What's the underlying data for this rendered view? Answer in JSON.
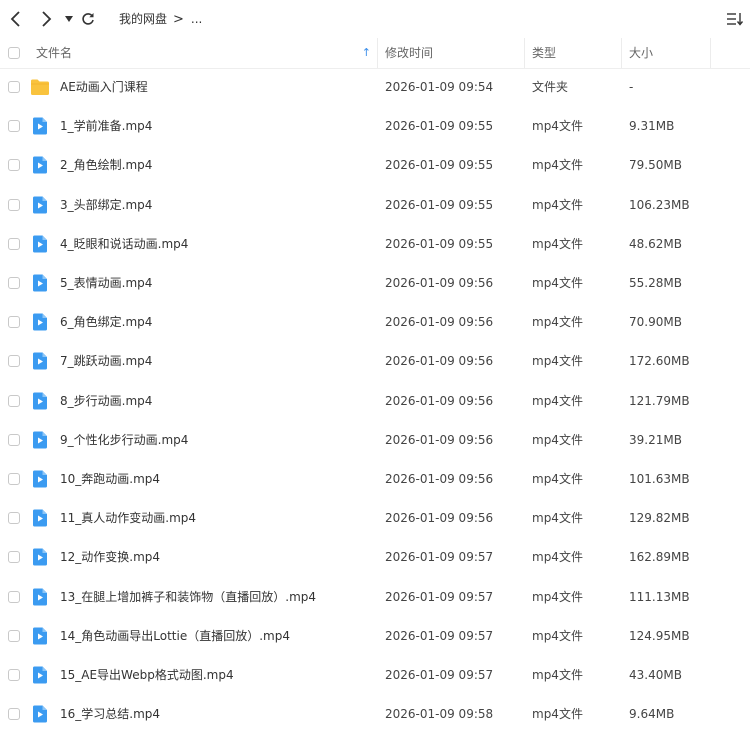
{
  "toolbar": {
    "breadcrumb_root": "我的网盘",
    "breadcrumb_sep": ">",
    "breadcrumb_more": "...",
    "icons": {
      "back": "chevron-left-icon",
      "forward": "chevron-right-icon",
      "history": "dropdown-triangle-icon",
      "refresh": "refresh-icon",
      "sort": "sort-list-icon"
    }
  },
  "columns": {
    "name": "文件名",
    "modified": "修改时间",
    "type": "类型",
    "size": "大小",
    "sort_indicator": "↑"
  },
  "colors": {
    "folder": "#F9C33E",
    "video": "#3B9BF1",
    "sort_arrow": "#3B8EEA"
  },
  "files": [
    {
      "name": "AE动画入门课程",
      "modified": "2026-01-09 09:54",
      "type": "文件夹",
      "size": "-",
      "kind": "folder"
    },
    {
      "name": "1_学前准备.mp4",
      "modified": "2026-01-09 09:55",
      "type": "mp4文件",
      "size": "9.31MB",
      "kind": "video"
    },
    {
      "name": "2_角色绘制.mp4",
      "modified": "2026-01-09 09:55",
      "type": "mp4文件",
      "size": "79.50MB",
      "kind": "video"
    },
    {
      "name": "3_头部绑定.mp4",
      "modified": "2026-01-09 09:55",
      "type": "mp4文件",
      "size": "106.23MB",
      "kind": "video"
    },
    {
      "name": "4_眨眼和说话动画.mp4",
      "modified": "2026-01-09 09:55",
      "type": "mp4文件",
      "size": "48.62MB",
      "kind": "video"
    },
    {
      "name": "5_表情动画.mp4",
      "modified": "2026-01-09 09:56",
      "type": "mp4文件",
      "size": "55.28MB",
      "kind": "video"
    },
    {
      "name": "6_角色绑定.mp4",
      "modified": "2026-01-09 09:56",
      "type": "mp4文件",
      "size": "70.90MB",
      "kind": "video"
    },
    {
      "name": "7_跳跃动画.mp4",
      "modified": "2026-01-09 09:56",
      "type": "mp4文件",
      "size": "172.60MB",
      "kind": "video"
    },
    {
      "name": "8_步行动画.mp4",
      "modified": "2026-01-09 09:56",
      "type": "mp4文件",
      "size": "121.79MB",
      "kind": "video"
    },
    {
      "name": "9_个性化步行动画.mp4",
      "modified": "2026-01-09 09:56",
      "type": "mp4文件",
      "size": "39.21MB",
      "kind": "video"
    },
    {
      "name": "10_奔跑动画.mp4",
      "modified": "2026-01-09 09:56",
      "type": "mp4文件",
      "size": "101.63MB",
      "kind": "video"
    },
    {
      "name": "11_真人动作变动画.mp4",
      "modified": "2026-01-09 09:56",
      "type": "mp4文件",
      "size": "129.82MB",
      "kind": "video"
    },
    {
      "name": "12_动作变换.mp4",
      "modified": "2026-01-09 09:57",
      "type": "mp4文件",
      "size": "162.89MB",
      "kind": "video"
    },
    {
      "name": "13_在腿上增加裤子和装饰物（直播回放）.mp4",
      "modified": "2026-01-09 09:57",
      "type": "mp4文件",
      "size": "111.13MB",
      "kind": "video"
    },
    {
      "name": "14_角色动画导出Lottie（直播回放）.mp4",
      "modified": "2026-01-09 09:57",
      "type": "mp4文件",
      "size": "124.95MB",
      "kind": "video"
    },
    {
      "name": "15_AE导出Webp格式动图.mp4",
      "modified": "2026-01-09 09:57",
      "type": "mp4文件",
      "size": "43.40MB",
      "kind": "video"
    },
    {
      "name": "16_学习总结.mp4",
      "modified": "2026-01-09 09:58",
      "type": "mp4文件",
      "size": "9.64MB",
      "kind": "video"
    }
  ]
}
